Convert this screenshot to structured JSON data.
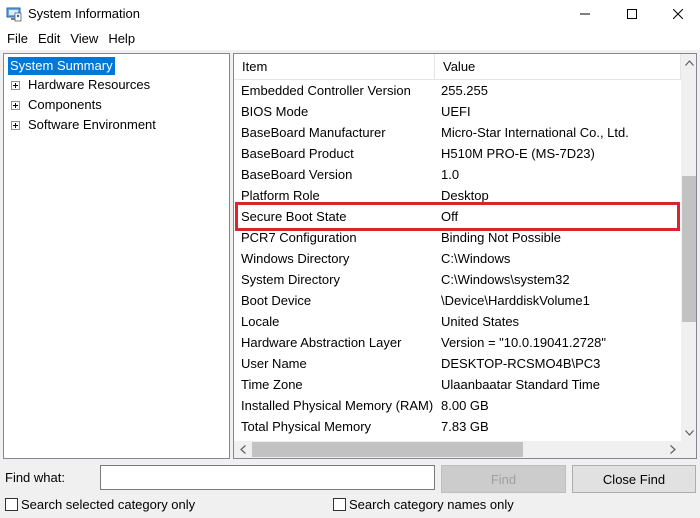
{
  "window": {
    "title": "System Information",
    "app_icon": "system-information-icon",
    "buttons": {
      "minimize": "minimize-icon",
      "maximize": "maximize-icon",
      "close": "close-icon"
    }
  },
  "menu": [
    "File",
    "Edit",
    "View",
    "Help"
  ],
  "tree": {
    "selected": "System Summary",
    "items": [
      "Hardware Resources",
      "Components",
      "Software Environment"
    ]
  },
  "table": {
    "columns": [
      "Item",
      "Value"
    ],
    "rows": [
      [
        "Embedded Controller Version",
        "255.255"
      ],
      [
        "BIOS Mode",
        "UEFI"
      ],
      [
        "BaseBoard Manufacturer",
        "Micro-Star International Co., Ltd."
      ],
      [
        "BaseBoard Product",
        "H510M PRO-E (MS-7D23)"
      ],
      [
        "BaseBoard Version",
        "1.0"
      ],
      [
        "Platform Role",
        "Desktop"
      ],
      [
        "Secure Boot State",
        "Off"
      ],
      [
        "PCR7 Configuration",
        "Binding Not Possible"
      ],
      [
        "Windows Directory",
        "C:\\Windows"
      ],
      [
        "System Directory",
        "C:\\Windows\\system32"
      ],
      [
        "Boot Device",
        "\\Device\\HarddiskVolume1"
      ],
      [
        "Locale",
        "United States"
      ],
      [
        "Hardware Abstraction Layer",
        "Version = \"10.0.19041.2728\""
      ],
      [
        "User Name",
        "DESKTOP-RCSMO4B\\PC3"
      ],
      [
        "Time Zone",
        "Ulaanbaatar Standard Time"
      ],
      [
        "Installed Physical Memory (RAM)",
        "8.00 GB"
      ],
      [
        "Total Physical Memory",
        "7.83 GB"
      ]
    ],
    "highlight_color": "#d9252b"
  },
  "find": {
    "label": "Find what:",
    "value": "",
    "find_button": "Find",
    "close_button": "Close Find",
    "check_selected": "Search selected category only",
    "check_names": "Search category names only"
  },
  "colors": {
    "selection": "#0078d7"
  }
}
